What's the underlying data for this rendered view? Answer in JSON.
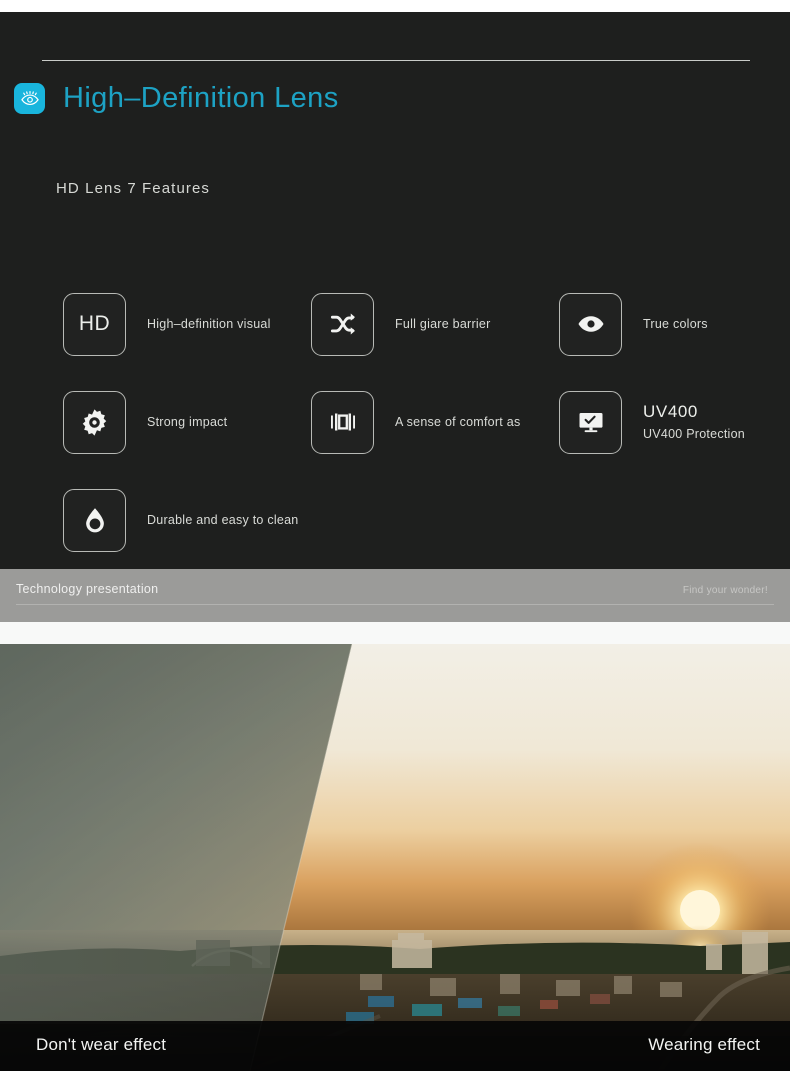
{
  "header": {
    "icon": "eye-icon",
    "title": "High–Definition Lens",
    "accent_color": "#1da2c4",
    "icon_bg_color": "#19b5dd"
  },
  "section": {
    "subtitle": "HD Lens 7 Features"
  },
  "features": [
    {
      "icon": "hd-icon",
      "badge_text": "HD",
      "label": "High–definition visual",
      "sublabel": ""
    },
    {
      "icon": "shuffle-icon",
      "badge_text": "",
      "label": "Full giare barrier",
      "sublabel": ""
    },
    {
      "icon": "eye-open-icon",
      "badge_text": "",
      "label": "True colors",
      "sublabel": ""
    },
    {
      "icon": "gear-icon",
      "badge_text": "",
      "label": "Strong impact",
      "sublabel": ""
    },
    {
      "icon": "panorama-icon",
      "badge_text": "",
      "label": "A sense of comfort as",
      "sublabel": ""
    },
    {
      "icon": "monitor-check-icon",
      "badge_text": "",
      "label": "UV400",
      "sublabel": "UV400 Protection"
    },
    {
      "icon": "water-drop-icon",
      "badge_text": "",
      "label": "Durable and easy to clean",
      "sublabel": ""
    }
  ],
  "footer_bar": {
    "label": "Technology presentation",
    "tagline": "Find your wonder!",
    "bg_color": "#9b9b99"
  },
  "photo": {
    "caption_left": "Don't wear effect",
    "caption_right": "Wearing effect",
    "description": "Coastal town at sunset split diagonally — hazy washed-out left side, clear vivid right side"
  }
}
